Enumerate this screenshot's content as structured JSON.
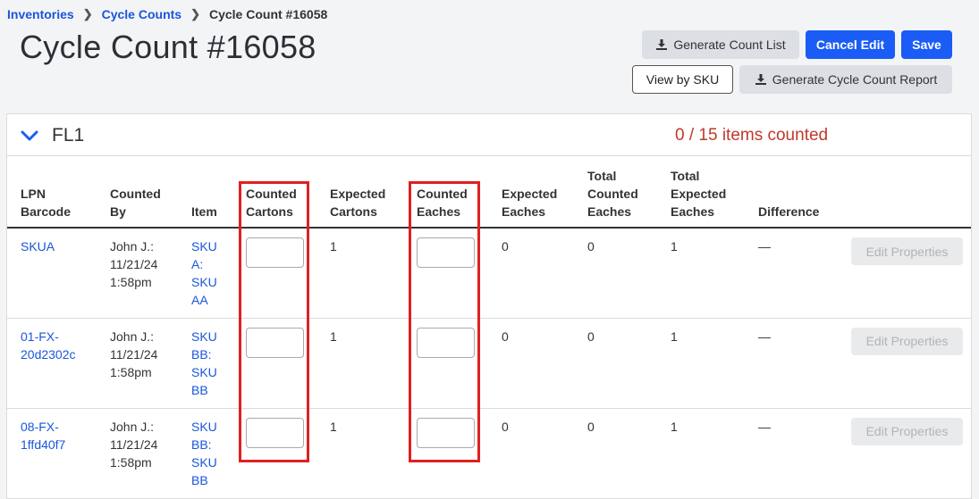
{
  "breadcrumb": {
    "items": [
      "Inventories",
      "Cycle Counts"
    ],
    "current": "Cycle Count #16058"
  },
  "page_title": "Cycle Count #16058",
  "toolbar": {
    "generate_count_list": "Generate Count List",
    "cancel_edit": "Cancel Edit",
    "save": "Save",
    "view_by_sku": "View by SKU",
    "generate_report": "Generate Cycle Count Report"
  },
  "zone": {
    "name": "FL1",
    "status": "0 / 15 items counted"
  },
  "table": {
    "headers": {
      "lpn": [
        "LPN",
        "Barcode"
      ],
      "counted_by": [
        "Counted",
        "By"
      ],
      "item": [
        "Item"
      ],
      "counted_cartons": [
        "Counted",
        "Cartons"
      ],
      "expected_cartons": [
        "Expected",
        "Cartons"
      ],
      "counted_eaches": [
        "Counted",
        "Eaches"
      ],
      "expected_eaches": [
        "Expected",
        "Eaches"
      ],
      "total_counted": [
        "Total",
        "Counted",
        "Eaches"
      ],
      "total_expected": [
        "Total",
        "Expected",
        "Eaches"
      ],
      "difference": [
        "Difference"
      ]
    },
    "rows": [
      {
        "lpn": [
          "SKUA"
        ],
        "counted_by": [
          "John J.:",
          "11/21/24",
          "1:58pm"
        ],
        "item": [
          "SKU",
          "A:",
          "SKU",
          "AA"
        ],
        "expected_cartons": "1",
        "expected_eaches": "0",
        "total_counted": "0",
        "total_expected": "1",
        "difference": "—",
        "action": "Edit Properties"
      },
      {
        "lpn": [
          "01-FX-",
          "20d2302c"
        ],
        "counted_by": [
          "John J.:",
          "11/21/24",
          "1:58pm"
        ],
        "item": [
          "SKU",
          "BB:",
          "SKU",
          "BB"
        ],
        "expected_cartons": "1",
        "expected_eaches": "0",
        "total_counted": "0",
        "total_expected": "1",
        "difference": "—",
        "action": "Edit Properties"
      },
      {
        "lpn": [
          "08-FX-",
          "1ffd40f7"
        ],
        "counted_by": [
          "John J.:",
          "11/21/24",
          "1:58pm"
        ],
        "item": [
          "SKU",
          "BB:",
          "SKU",
          "BB"
        ],
        "expected_cartons": "1",
        "expected_eaches": "0",
        "total_counted": "0",
        "total_expected": "1",
        "difference": "—",
        "action": "Edit Properties"
      }
    ]
  },
  "colors": {
    "accent": "#1a5cf5",
    "status_red": "#c0392b",
    "highlight": "#e02020"
  }
}
